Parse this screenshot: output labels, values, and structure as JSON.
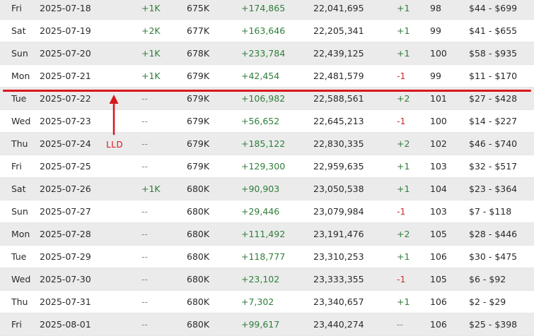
{
  "rows": [
    {
      "day": "Fri",
      "date": "2025-07-18",
      "subs_change": "+1K",
      "subs": "675K",
      "views_change": "+174,865",
      "total_views": "22,041,695",
      "rank_change": "+1",
      "rank": "98",
      "earnings": "$44 - $699"
    },
    {
      "day": "Sat",
      "date": "2025-07-19",
      "subs_change": "+2K",
      "subs": "677K",
      "views_change": "+163,646",
      "total_views": "22,205,341",
      "rank_change": "+1",
      "rank": "99",
      "earnings": "$41 - $655"
    },
    {
      "day": "Sun",
      "date": "2025-07-20",
      "subs_change": "+1K",
      "subs": "678K",
      "views_change": "+233,784",
      "total_views": "22,439,125",
      "rank_change": "+1",
      "rank": "100",
      "earnings": "$58 - $935"
    },
    {
      "day": "Mon",
      "date": "2025-07-21",
      "subs_change": "+1K",
      "subs": "679K",
      "views_change": "+42,454",
      "total_views": "22,481,579",
      "rank_change": "-1",
      "rank": "99",
      "earnings": "$11 - $170"
    },
    {
      "day": "Tue",
      "date": "2025-07-22",
      "subs_change": "--",
      "subs": "679K",
      "views_change": "+106,982",
      "total_views": "22,588,561",
      "rank_change": "+2",
      "rank": "101",
      "earnings": "$27 - $428"
    },
    {
      "day": "Wed",
      "date": "2025-07-23",
      "subs_change": "--",
      "subs": "679K",
      "views_change": "+56,652",
      "total_views": "22,645,213",
      "rank_change": "-1",
      "rank": "100",
      "earnings": "$14 - $227"
    },
    {
      "day": "Thu",
      "date": "2025-07-24",
      "subs_change": "--",
      "subs": "679K",
      "views_change": "+185,122",
      "total_views": "22,830,335",
      "rank_change": "+2",
      "rank": "102",
      "earnings": "$46 - $740"
    },
    {
      "day": "Fri",
      "date": "2025-07-25",
      "subs_change": "--",
      "subs": "679K",
      "views_change": "+129,300",
      "total_views": "22,959,635",
      "rank_change": "+1",
      "rank": "103",
      "earnings": "$32 - $517"
    },
    {
      "day": "Sat",
      "date": "2025-07-26",
      "subs_change": "+1K",
      "subs": "680K",
      "views_change": "+90,903",
      "total_views": "23,050,538",
      "rank_change": "+1",
      "rank": "104",
      "earnings": "$23 - $364"
    },
    {
      "day": "Sun",
      "date": "2025-07-27",
      "subs_change": "--",
      "subs": "680K",
      "views_change": "+29,446",
      "total_views": "23,079,984",
      "rank_change": "-1",
      "rank": "103",
      "earnings": "$7 - $118"
    },
    {
      "day": "Mon",
      "date": "2025-07-28",
      "subs_change": "--",
      "subs": "680K",
      "views_change": "+111,492",
      "total_views": "23,191,476",
      "rank_change": "+2",
      "rank": "105",
      "earnings": "$28 - $446"
    },
    {
      "day": "Tue",
      "date": "2025-07-29",
      "subs_change": "--",
      "subs": "680K",
      "views_change": "+118,777",
      "total_views": "23,310,253",
      "rank_change": "+1",
      "rank": "106",
      "earnings": "$30 - $475"
    },
    {
      "day": "Wed",
      "date": "2025-07-30",
      "subs_change": "--",
      "subs": "680K",
      "views_change": "+23,102",
      "total_views": "23,333,355",
      "rank_change": "-1",
      "rank": "105",
      "earnings": "$6 - $92"
    },
    {
      "day": "Thu",
      "date": "2025-07-31",
      "subs_change": "--",
      "subs": "680K",
      "views_change": "+7,302",
      "total_views": "23,340,657",
      "rank_change": "+1",
      "rank": "106",
      "earnings": "$2 - $29"
    },
    {
      "day": "Fri",
      "date": "2025-08-01",
      "subs_change": "--",
      "subs": "680K",
      "views_change": "+99,617",
      "total_views": "23,440,274",
      "rank_change": "--",
      "rank": "106",
      "earnings": "$25 - $398"
    }
  ],
  "annotation": {
    "label": "LLD",
    "color": "#d9161c"
  },
  "colors": {
    "positive": "#2f7d3a",
    "negative": "#c9302c",
    "neutral": "#8a8a8a",
    "row_alt": "#ebebeb"
  }
}
